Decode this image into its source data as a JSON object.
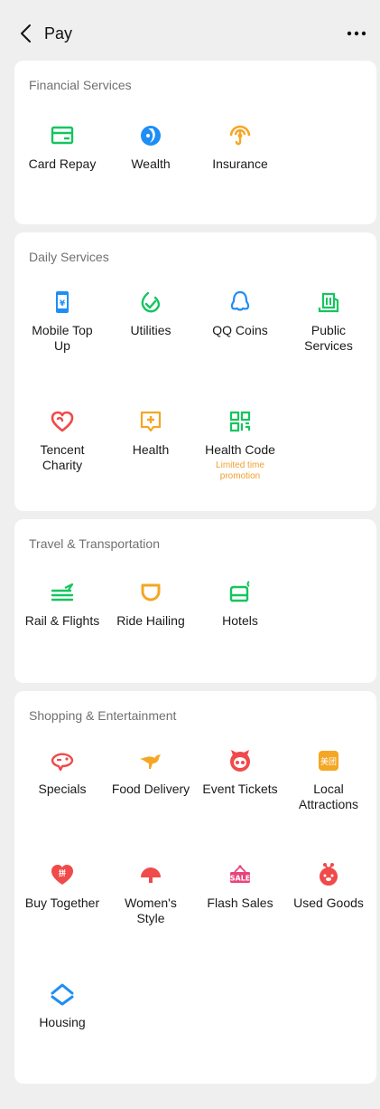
{
  "header": {
    "title": "Pay",
    "back_icon": "chevron-left-icon",
    "more_icon": "more-dots-icon"
  },
  "colors": {
    "green": "#14c55f",
    "blue": "#1e8ef5",
    "orange": "#f5a623",
    "red": "#f04a4a",
    "pink": "#e8457a",
    "note": "#f0a030"
  },
  "sections": [
    {
      "title": "Financial Services",
      "items": [
        {
          "label": "Card Repay",
          "icon": "card-repay-icon"
        },
        {
          "label": "Wealth",
          "icon": "wealth-icon"
        },
        {
          "label": "Insurance",
          "icon": "insurance-icon"
        }
      ]
    },
    {
      "title": "Daily Services",
      "items": [
        {
          "label": "Mobile Top\nUp",
          "icon": "mobile-top-up-icon"
        },
        {
          "label": "Utilities",
          "icon": "utilities-icon"
        },
        {
          "label": "QQ Coins",
          "icon": "qq-coins-icon"
        },
        {
          "label": "Public\nServices",
          "icon": "public-services-icon"
        },
        {
          "label": "Tencent\nCharity",
          "icon": "charity-heart-icon"
        },
        {
          "label": "Health",
          "icon": "health-icon"
        },
        {
          "label": "Health Code",
          "icon": "qr-code-icon",
          "note": "Limited time\npromotion"
        }
      ]
    },
    {
      "title": "Travel & Transportation",
      "items": [
        {
          "label": "Rail & Flights",
          "icon": "rail-flights-icon"
        },
        {
          "label": "Ride Hailing",
          "icon": "ride-hailing-icon"
        },
        {
          "label": "Hotels",
          "icon": "hotel-bed-icon"
        }
      ]
    },
    {
      "title": "Shopping & Entertainment",
      "items": [
        {
          "label": "Specials",
          "icon": "specials-icon"
        },
        {
          "label": "Food Delivery",
          "icon": "food-delivery-icon"
        },
        {
          "label": "Event Tickets",
          "icon": "event-tickets-icon"
        },
        {
          "label": "Local\nAttractions",
          "icon": "local-attractions-icon",
          "badge": "美团"
        },
        {
          "label": "Buy Together",
          "icon": "buy-together-icon",
          "badge": "拼"
        },
        {
          "label": "Women's\nStyle",
          "icon": "womens-style-icon"
        },
        {
          "label": "Flash Sales",
          "icon": "flash-sales-icon",
          "badge": "SALE"
        },
        {
          "label": "Used Goods",
          "icon": "used-goods-icon"
        },
        {
          "label": "Housing",
          "icon": "housing-icon"
        }
      ]
    }
  ]
}
